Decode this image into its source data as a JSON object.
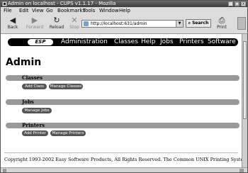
{
  "window": {
    "title": "Admin on localhost - CUPS v1.1.17 - Mozilla"
  },
  "menu": [
    "File",
    "Edit",
    "View",
    "Go",
    "Bookmarks",
    "Tools",
    "Window",
    "Help"
  ],
  "toolbar": {
    "back": "Back",
    "forward": "Forward",
    "reload": "Reload",
    "stop": "Stop",
    "search": "Search",
    "print": "Print"
  },
  "address": {
    "url": "http://localhost:631/admin"
  },
  "nav": {
    "logo": "ESP",
    "links": [
      "Administration",
      "Classes",
      "Help",
      "Jobs",
      "Printers",
      "Software"
    ]
  },
  "page": {
    "title": "Admin"
  },
  "sections": [
    {
      "title": "Classes",
      "buttons": [
        "Add Class",
        "Manage Classes"
      ]
    },
    {
      "title": "Jobs",
      "buttons": [
        "Manage Jobs"
      ]
    },
    {
      "title": "Printers",
      "buttons": [
        "Add Printer",
        "Manage Printers"
      ]
    }
  ],
  "footer": {
    "text": "Copyright 1993-2002 Easy Software Products, All Rights Reserved. The Common UNIX Printing System,"
  }
}
